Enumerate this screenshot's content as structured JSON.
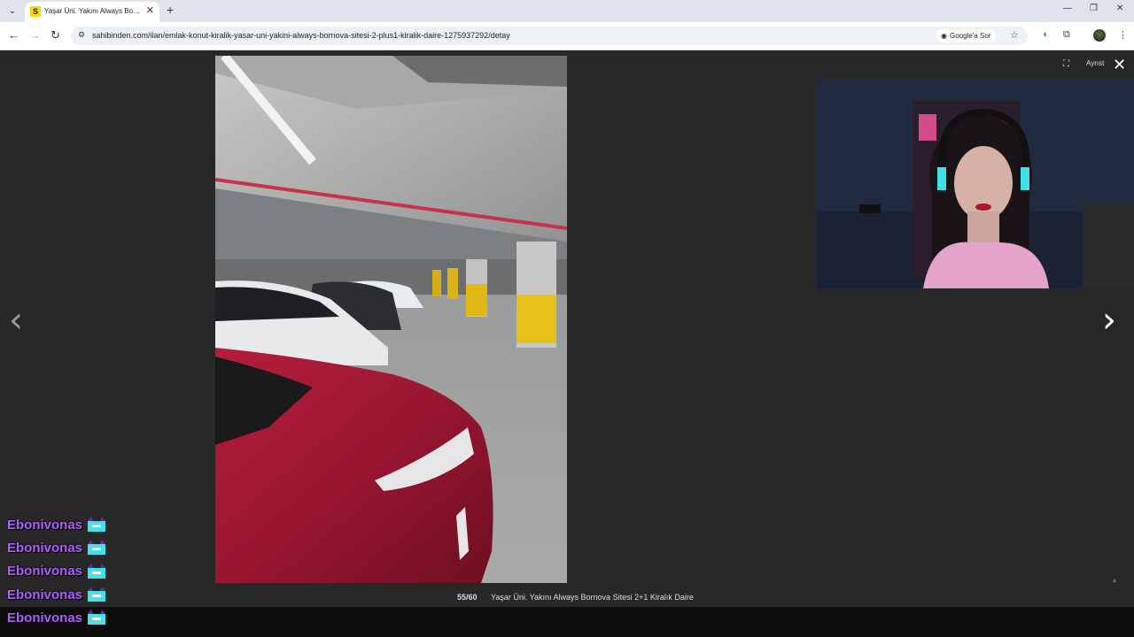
{
  "browser": {
    "tab_title": "Yaşar Üni. Yakını Always Bornova",
    "tab_favicon": "S",
    "url": "sahibinden.com/ilan/emlak-konut-kiralik-yasar-uni-yakini-always-bornova-sitesi-2-plus1-kiralik-daire-1275937292/detay",
    "google_button_label": "Google'a Sor",
    "icons": {
      "tab_menu": "chevron-down-icon",
      "tab_close": "close-icon",
      "new_tab": "plus-icon",
      "back": "arrow-left-icon",
      "forward": "arrow-right-icon",
      "reload": "reload-icon",
      "site_info": "tune-icon",
      "bookmark": "star-icon",
      "extensions": "puzzle-icon",
      "menu": "kebab-icon"
    }
  },
  "viewer": {
    "counter": "55/60",
    "caption": "Yaşar Üni. Yakını Always Bornova Sitesi 2+1 Kiralık Daire",
    "top_right_label": "Ayrıst",
    "icons": {
      "prev": "chevron-left-icon",
      "next": "chevron-right-icon",
      "close": "close-icon",
      "fullscreen": "fullscreen-icon"
    }
  },
  "chat": {
    "messages": [
      {
        "user": "Ebonivonas"
      },
      {
        "user": "Ebonivonas"
      },
      {
        "user": "Ebonivonas"
      },
      {
        "user": "Ebonivonas"
      },
      {
        "user": "Ebonivonas"
      }
    ]
  },
  "colors": {
    "viewer_bg": "#282828",
    "chat_username": "#b35cff",
    "taskbar": "#0c0c0c"
  }
}
